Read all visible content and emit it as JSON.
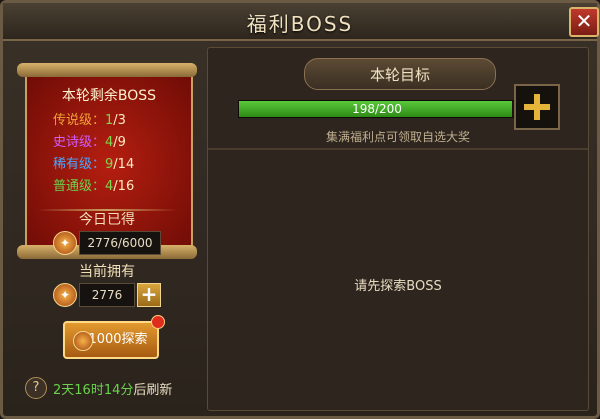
{
  "window": {
    "title": "福利BOSS",
    "close_label": "✕"
  },
  "left": {
    "header": "本轮剩余BOSS",
    "tiers": [
      {
        "label": "传说级：",
        "current": "1",
        "total": "/3",
        "color": "#f2a23a"
      },
      {
        "label": "史诗级：",
        "current": "4",
        "total": "/9",
        "color": "#d15cff"
      },
      {
        "label": "稀有级：",
        "current": "9",
        "total": "/14",
        "color": "#4aa6ff"
      },
      {
        "label": "普通级：",
        "current": "4",
        "total": "/16",
        "color": "#6ad24b"
      }
    ],
    "today_label": "今日已得",
    "today_value": "2776/6000",
    "owned_label": "当前拥有",
    "owned_value": "2776",
    "plus_label": "+",
    "explore_label": "1000探索",
    "help_label": "?",
    "refresh_time": "2天16时14分",
    "refresh_suffix": "后刷新"
  },
  "right": {
    "banner": "本轮目标",
    "progress_text": "198/200",
    "progress_fraction": 0.99,
    "hint": "集满福利点可领取自选大奖",
    "empty_text": "请先探索BOSS"
  }
}
